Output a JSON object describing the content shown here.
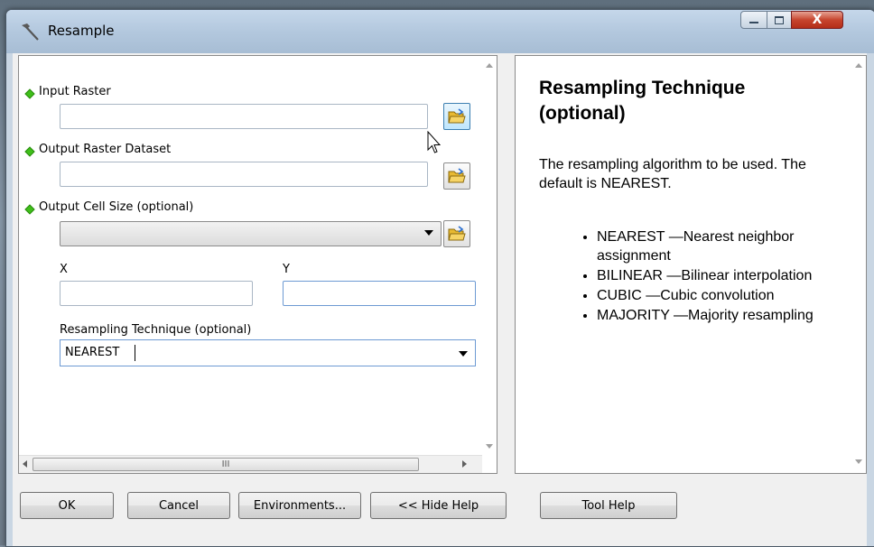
{
  "window": {
    "title": "Resample",
    "close_glyph": "X",
    "colors": {
      "titlebar": "#b3c8de",
      "close": "#c7452e",
      "required_marker": "#3fbf1a"
    }
  },
  "icons": {
    "title": "hammer-icon",
    "browse": "open-folder-icon",
    "minimize": "minimize-icon",
    "maximize": "maximize-icon",
    "close": "close-icon",
    "pointer": "mouse-pointer-icon"
  },
  "form": {
    "input_raster": {
      "label": "Input Raster",
      "value": ""
    },
    "output_raster": {
      "label": "Output Raster Dataset",
      "value": ""
    },
    "cell_size": {
      "label": "Output Cell Size (optional)",
      "value": ""
    },
    "x": {
      "label": "X",
      "value": ""
    },
    "y": {
      "label": "Y",
      "value": ""
    },
    "technique": {
      "label": "Resampling Technique (optional)",
      "value": "NEAREST"
    },
    "hscroll_grip": "III"
  },
  "help": {
    "title": "Resampling Technique (optional)",
    "description": "The resampling algorithm to be used. The default is NEAREST.",
    "items": [
      "NEAREST —Nearest neighbor assignment",
      "BILINEAR —Bilinear interpolation",
      "CUBIC —Cubic convolution",
      "MAJORITY —Majority resampling"
    ]
  },
  "buttons": {
    "ok": "OK",
    "cancel": "Cancel",
    "environments": "Environments...",
    "hide_help": "<< Hide Help",
    "tool_help": "Tool Help"
  }
}
